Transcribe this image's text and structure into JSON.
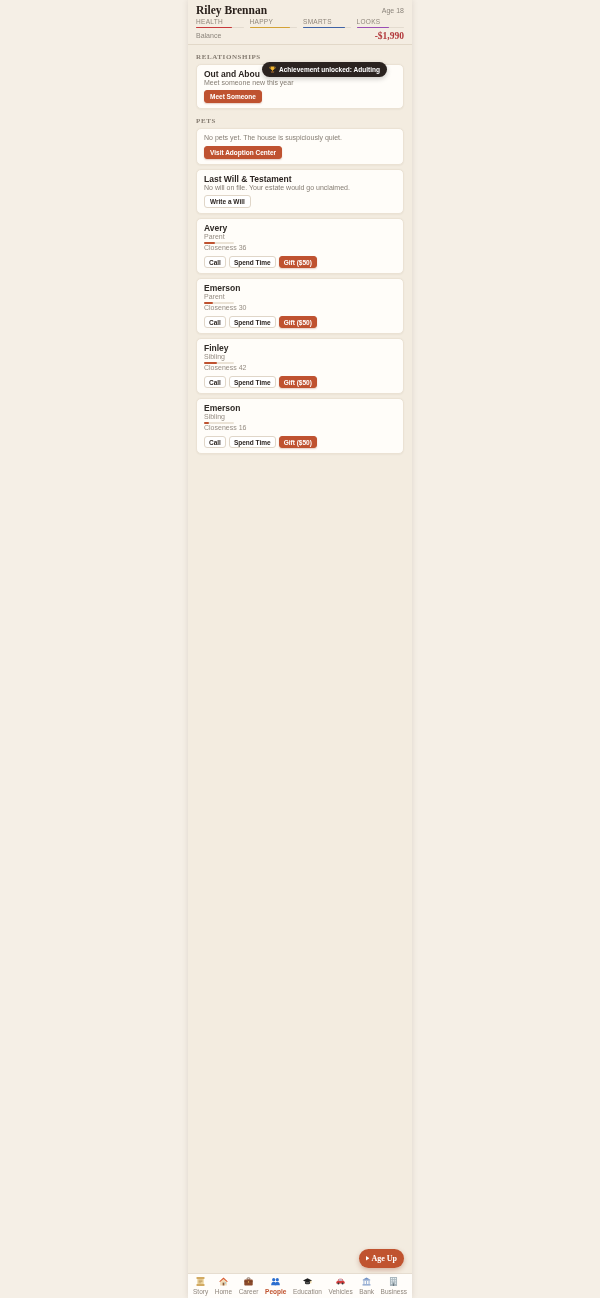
{
  "header": {
    "name": "Riley Brennan",
    "age": "Age 18",
    "stats": [
      {
        "label": "HEALTH",
        "level": 0.75,
        "color": "#c8393b"
      },
      {
        "label": "HAPPY",
        "level": 0.86,
        "color": "#d4a236"
      },
      {
        "label": "SMARTS",
        "level": 0.88,
        "color": "#3f63a6"
      },
      {
        "label": "LOOKS",
        "level": 0.68,
        "color": "#9a4fb5"
      }
    ],
    "balance": {
      "label": "Balance",
      "value": "-$1,990"
    }
  },
  "toast": {
    "text": "Achievement unlocked: Adulting"
  },
  "sections": [
    {
      "title": "RELATIONSHIPS",
      "cards": [
        {
          "kind": "action",
          "title": "Out and Abou",
          "description": "Meet someone new this year",
          "buttons": [
            {
              "label": "Meet Someone",
              "kind": "primary"
            }
          ]
        }
      ]
    },
    {
      "title": "PETS",
      "cards": [
        {
          "kind": "notice",
          "description": "No pets yet. The house is suspiciously quiet.",
          "buttons": [
            {
              "label": "Visit Adoption Center",
              "kind": "primary"
            }
          ]
        },
        {
          "kind": "action",
          "title": "Last Will & Testament",
          "description": "No will on file. Your estate would go unclaimed.",
          "buttons": [
            {
              "label": "Write a Will",
              "kind": "secondary"
            }
          ]
        },
        {
          "kind": "person",
          "name": "Avery",
          "relation": "Parent",
          "level": 0.36,
          "closeness": "Closeness 36",
          "buttons": [
            {
              "label": "Call",
              "kind": "secondary"
            },
            {
              "label": "Spend Time",
              "kind": "secondary"
            },
            {
              "label": "Gift ($50)",
              "kind": "primary"
            }
          ]
        },
        {
          "kind": "person",
          "name": "Emerson",
          "relation": "Parent",
          "level": 0.3,
          "closeness": "Closeness 30",
          "buttons": [
            {
              "label": "Call",
              "kind": "secondary"
            },
            {
              "label": "Spend Time",
              "kind": "secondary"
            },
            {
              "label": "Gift ($50)",
              "kind": "primary"
            }
          ]
        },
        {
          "kind": "person",
          "name": "Finley",
          "relation": "Sibling",
          "level": 0.42,
          "closeness": "Closeness 42",
          "buttons": [
            {
              "label": "Call",
              "kind": "secondary"
            },
            {
              "label": "Spend Time",
              "kind": "secondary"
            },
            {
              "label": "Gift ($50)",
              "kind": "primary"
            }
          ]
        },
        {
          "kind": "person",
          "name": "Emerson",
          "relation": "Sibling",
          "level": 0.16,
          "closeness": "Closeness 16",
          "buttons": [
            {
              "label": "Call",
              "kind": "secondary"
            },
            {
              "label": "Spend Time",
              "kind": "secondary"
            },
            {
              "label": "Gift ($50)",
              "kind": "primary"
            }
          ]
        }
      ]
    }
  ],
  "age_up": {
    "label": "Age Up"
  },
  "nav": [
    {
      "label": "Story",
      "selected": false
    },
    {
      "label": "Home",
      "selected": false
    },
    {
      "label": "Career",
      "selected": false
    },
    {
      "label": "People",
      "selected": true
    },
    {
      "label": "Education",
      "selected": false
    },
    {
      "label": "Vehicles",
      "selected": false
    },
    {
      "label": "Bank",
      "selected": false
    },
    {
      "label": "Business",
      "selected": false
    }
  ]
}
